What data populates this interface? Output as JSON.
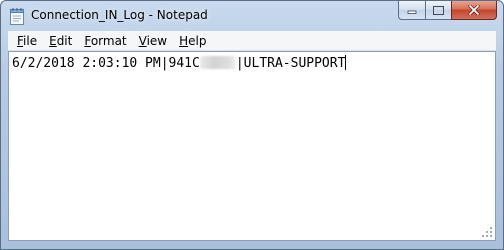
{
  "window": {
    "title": "Connection_IN_Log - Notepad",
    "app_icon": "notepad-icon",
    "accent_frame": "#b6cbe4",
    "close_color": "#c4452b"
  },
  "caption_buttons": {
    "minimize_icon": "minimize-icon",
    "maximize_icon": "maximize-icon",
    "close_icon": "close-icon"
  },
  "menu": {
    "items": [
      {
        "acc": "F",
        "rest": "ile"
      },
      {
        "acc": "E",
        "rest": "dit"
      },
      {
        "acc": "F",
        "rest": "ormat"
      },
      {
        "acc": "V",
        "rest": "iew"
      },
      {
        "acc": "H",
        "rest": "elp"
      }
    ]
  },
  "document": {
    "line_prefix": "6/2/2018 2:03:10 PM|941C",
    "line_suffix": "|ULTRA-SUPPORT",
    "redacted_segment": "blurred"
  }
}
